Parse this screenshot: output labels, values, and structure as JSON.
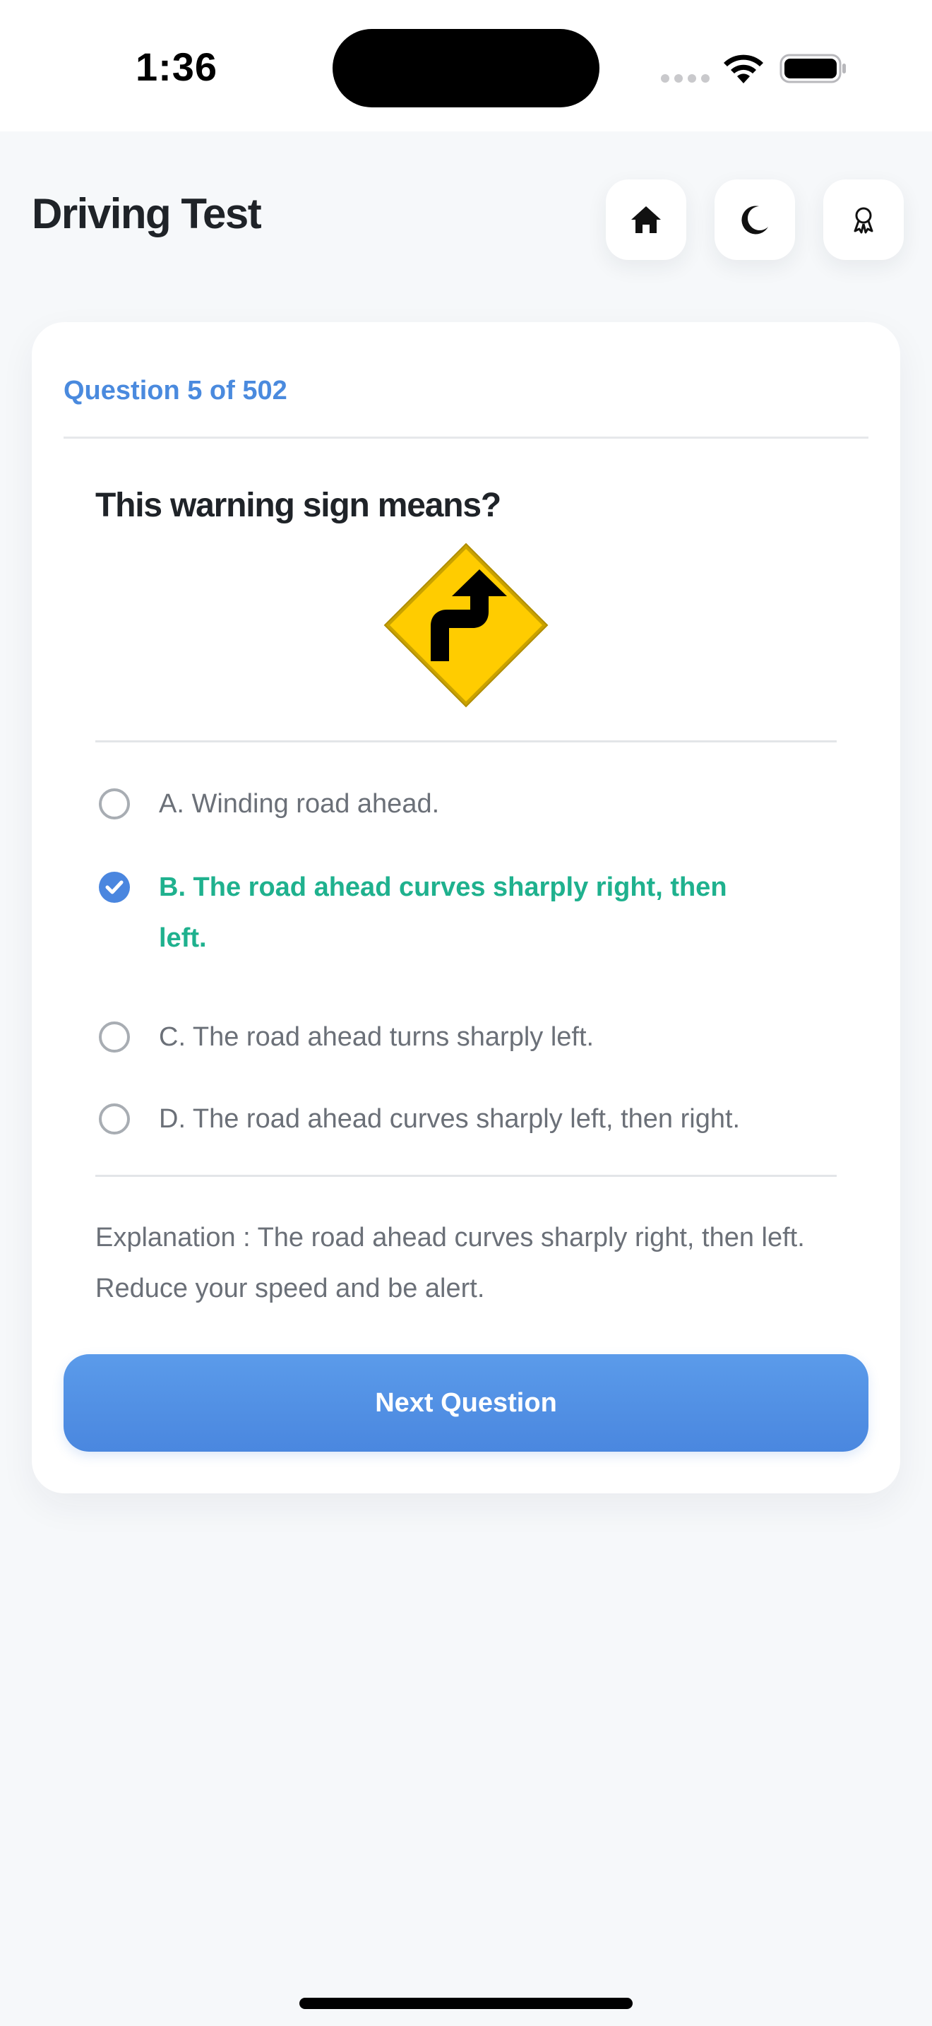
{
  "status_bar": {
    "time": "1:36",
    "icons": [
      "signal-dots-icon",
      "wifi-icon",
      "battery-icon"
    ]
  },
  "header": {
    "title": "Driving Test",
    "buttons": [
      {
        "name": "home-button",
        "icon": "home-icon"
      },
      {
        "name": "dark-mode-button",
        "icon": "moon-icon"
      },
      {
        "name": "achievements-button",
        "icon": "award-ribbon-icon"
      }
    ]
  },
  "quiz": {
    "counter": "Question 5 of 502",
    "question": "This warning sign means?",
    "sign_icon": "right-reverse-curve-warning-sign",
    "options": [
      {
        "label": "A. Winding road ahead.",
        "selected": false,
        "correct": false
      },
      {
        "label": "B. The road ahead curves sharply right, then left.",
        "selected": true,
        "correct": true
      },
      {
        "label": "C. The road ahead turns sharply left.",
        "selected": false,
        "correct": false
      },
      {
        "label": "D. The road ahead curves sharply left, then right.",
        "selected": false,
        "correct": false
      }
    ],
    "explanation": "Explanation : The road ahead curves sharply right, then left. Reduce your speed and be alert.",
    "next_label": "Next Question"
  },
  "colors": {
    "accent": "#4a86df",
    "correct": "#1fb18e",
    "background": "#f6f8fa",
    "card": "#ffffff",
    "sign_yellow": "#ffcc00"
  }
}
